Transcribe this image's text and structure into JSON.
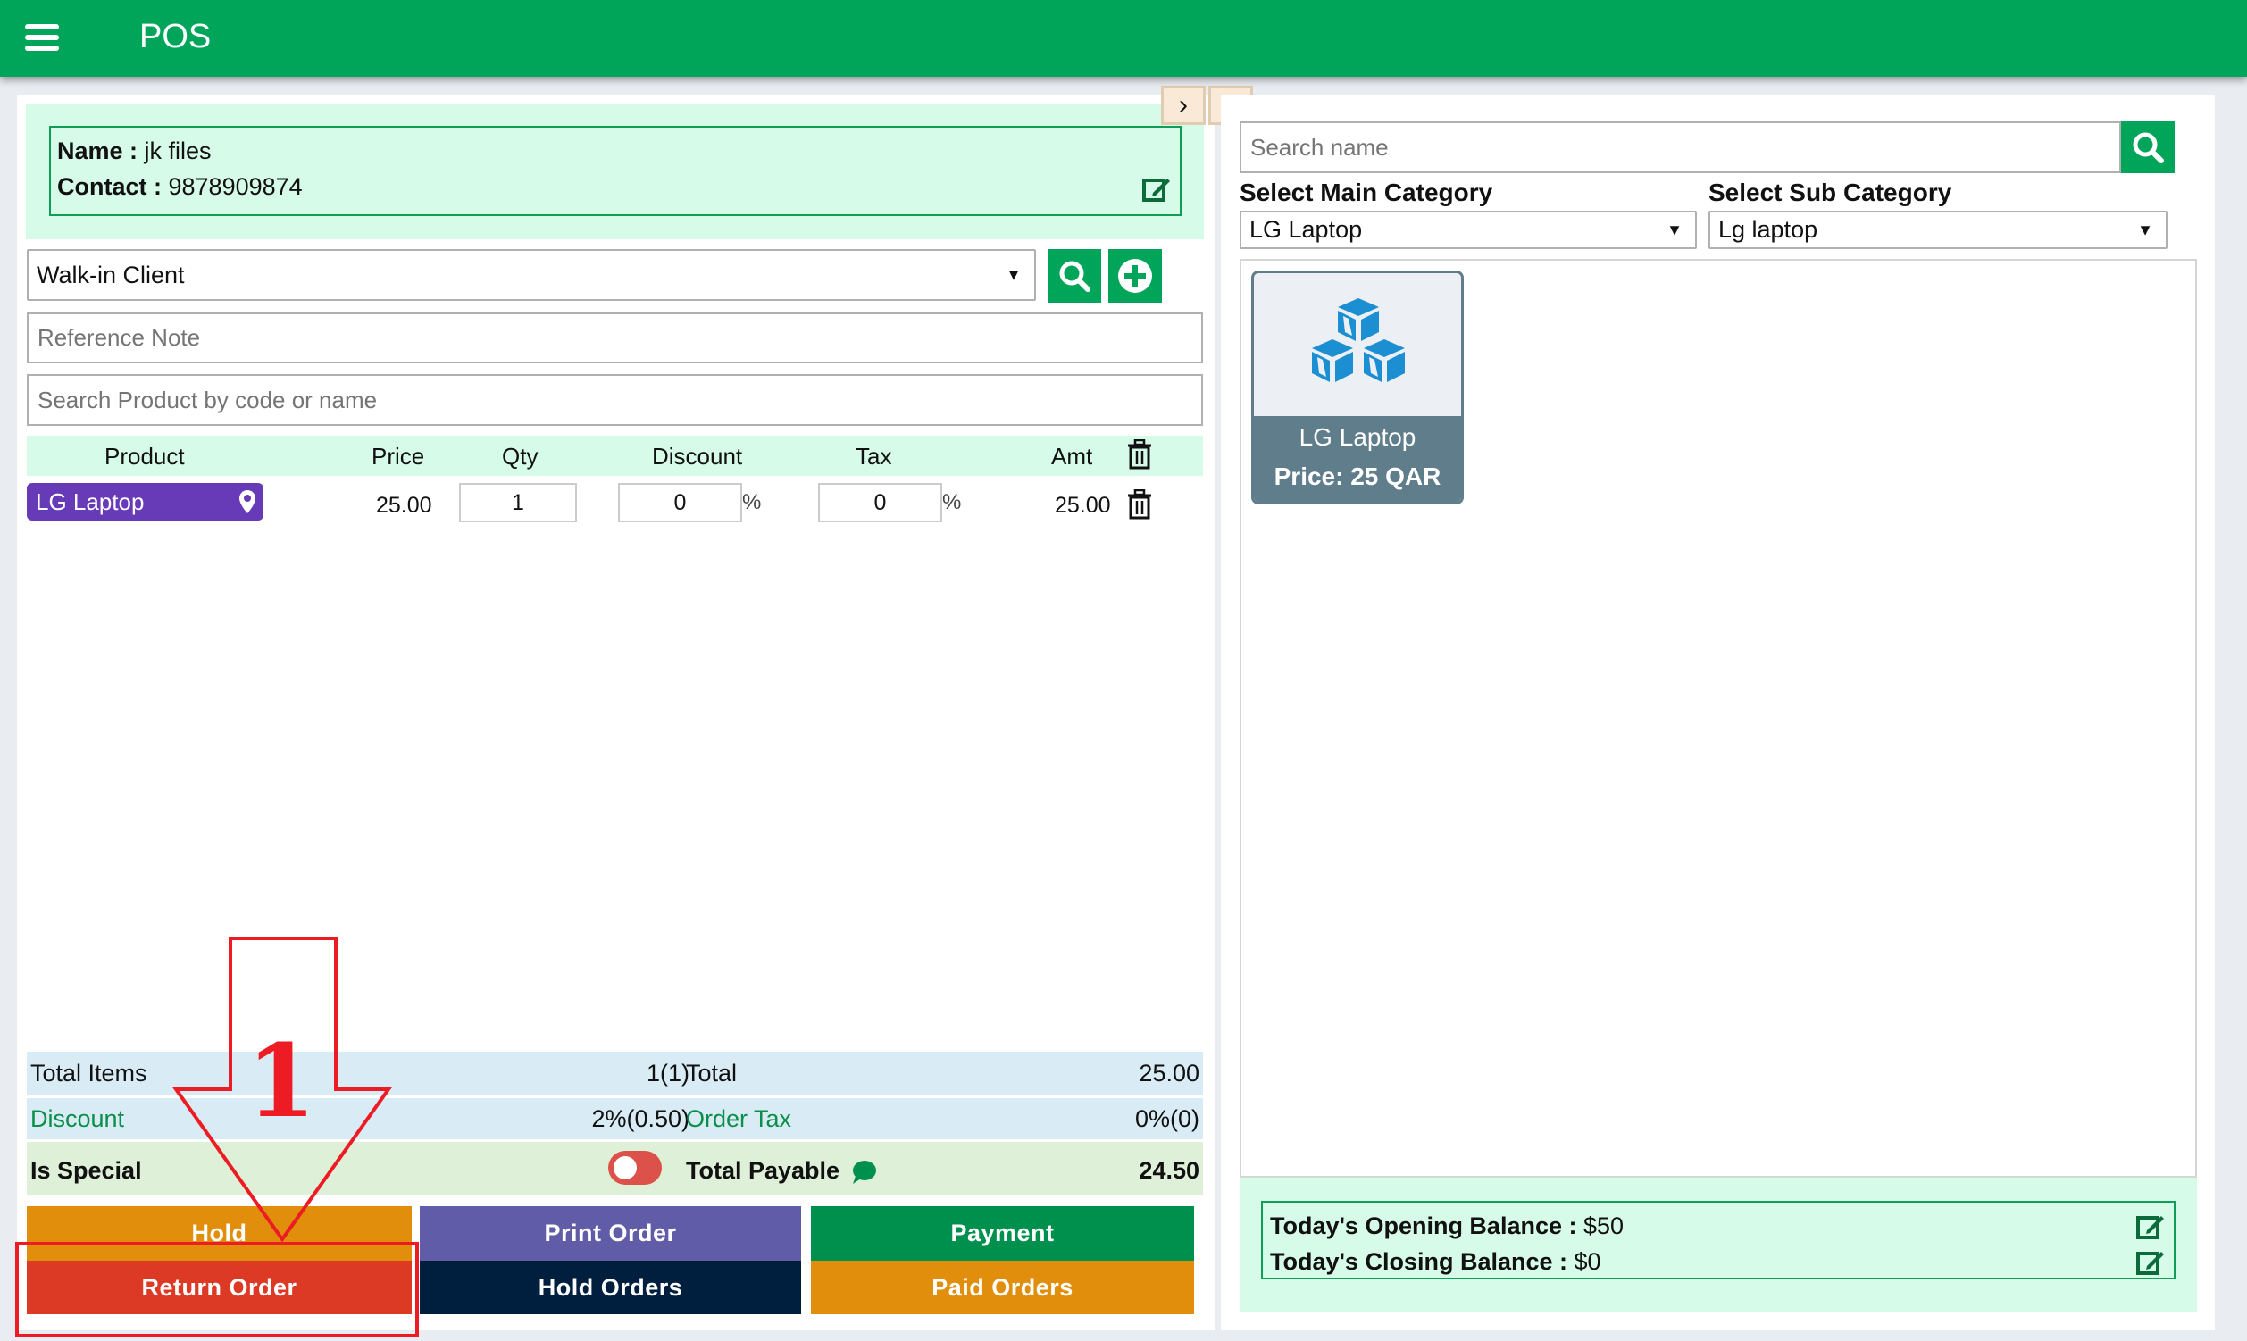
{
  "header": {
    "title": "POS",
    "menu_icon": "hamburger-menu-icon"
  },
  "collapse_toggles": {
    "expand_icon": "chevron-right",
    "collapse_icon": "chevron-left",
    "expand_glyph": "›",
    "collapse_glyph": "‹"
  },
  "customer_info": {
    "name_label": "Name :",
    "name_value": " jk files",
    "contact_label": "Contact :",
    "contact_value": " 9878909874"
  },
  "client_select": {
    "value": "Walk-in Client",
    "caret": "▼"
  },
  "reference_note": {
    "placeholder": "Reference Note",
    "value": ""
  },
  "product_search": {
    "placeholder": "Search Product by code or name",
    "value": ""
  },
  "cart_table": {
    "headers": {
      "product": "Product",
      "price": "Price",
      "qty": "Qty",
      "discount": "Discount",
      "tax": "Tax",
      "amt": "Amt"
    },
    "rows": [
      {
        "product": "LG Laptop",
        "price": "25.00",
        "qty": "1",
        "discount": "0",
        "discount_unit": "%",
        "tax": "0",
        "tax_unit": "%",
        "amt": "25.00"
      }
    ]
  },
  "totals": {
    "total_items_label": "Total Items",
    "total_items_value": "1(1)",
    "total_label": "Total",
    "total_value": "25.00",
    "discount_label": "Discount",
    "discount_value": "2%(0.50)",
    "order_tax_label": "Order Tax",
    "order_tax_value": "0%(0)",
    "is_special_label": "Is Special",
    "is_special_on": false,
    "total_payable_label": "Total Payable",
    "total_payable_value": "24.50"
  },
  "actions": {
    "hold": "Hold",
    "print_order": "Print Order",
    "payment": "Payment",
    "return_order": "Return Order",
    "hold_orders": "Hold Orders",
    "paid_orders": "Paid Orders"
  },
  "colors": {
    "brand_green": "#00a55a",
    "hold": "#e08e0b",
    "print_order": "#605ca8",
    "payment": "#00904e",
    "return_order": "#dd3a26",
    "hold_orders": "#001f3f",
    "paid_orders": "#e08e0b",
    "product_pill": "#673ab7",
    "annotation_red": "#ed1c24"
  },
  "right_panel": {
    "search": {
      "placeholder": "Search name",
      "value": ""
    },
    "main_category_label": "Select Main Category",
    "main_category_value": "LG Laptop",
    "sub_category_label": "Select Sub Category",
    "sub_category_value": "Lg laptop",
    "products": [
      {
        "name": "LG Laptop",
        "price": "Price: 25 QAR",
        "icon": "cubes-icon"
      }
    ],
    "balance": {
      "opening_label": "Today's Opening Balance :",
      "opening_value": " $50",
      "closing_label": "Today's Closing Balance :",
      "closing_value": " $0"
    }
  },
  "annotation": {
    "step_number": "1",
    "target": "Return Order"
  }
}
